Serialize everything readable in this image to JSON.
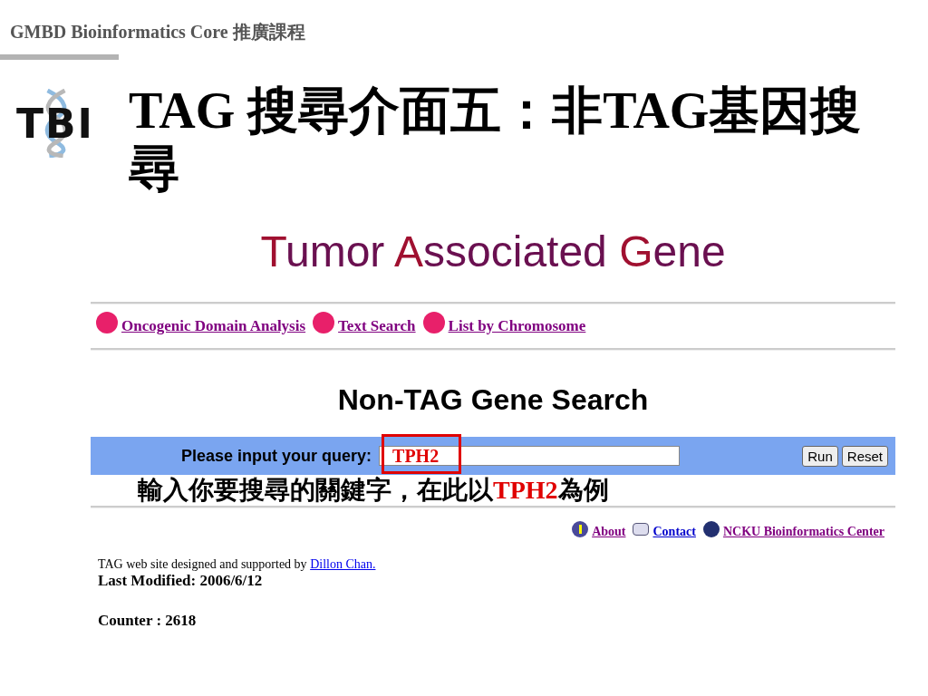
{
  "slide_header": "GMBD Bioinformatics Core 推廣課程",
  "logo": {
    "text": "TBI"
  },
  "slide_title": "TAG 搜尋介面五：非TAG基因搜尋",
  "web_page": {
    "site_title": [
      {
        "initial": "T",
        "rest": "umor"
      },
      {
        "initial": "A",
        "rest": "ssociated"
      },
      {
        "initial": "G",
        "rest": "ene"
      }
    ],
    "nav_links": [
      "Oncogenic Domain Analysis",
      "Text Search",
      "List by Chromosome"
    ],
    "heading": "Non-TAG Gene Search",
    "query_form": {
      "label": "Please input your query:",
      "value": "TPH2",
      "buttons": [
        "Run",
        "Reset"
      ]
    },
    "annotation": {
      "before": "輸入你要搜尋的關鍵字，在此以",
      "highlight": "TPH2",
      "after": "為例"
    },
    "footer_links": [
      {
        "kind": "info",
        "label": "About"
      },
      {
        "kind": "contact",
        "label": "Contact"
      },
      {
        "kind": "home",
        "label": "NCKU Bioinformatics Center"
      }
    ],
    "credit": {
      "text": "TAG web site designed and supported by",
      "link": "Dillon Chan."
    },
    "last_modified": "Last Modified: 2006/6/12",
    "counter": "Counter : 2618"
  }
}
